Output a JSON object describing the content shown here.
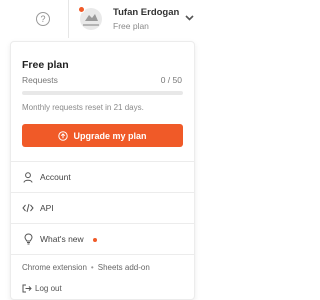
{
  "header": {
    "help_icon": "question-mark-icon",
    "user": {
      "name": "Tufan Erdogan",
      "plan": "Free plan",
      "has_notification": true
    }
  },
  "panel": {
    "plan_title": "Free plan",
    "requests_label": "Requests",
    "requests_count": "0 / 50",
    "requests_used_fraction": 0,
    "reset_text": "Monthly requests reset in 21 days.",
    "upgrade_label": "Upgrade my plan",
    "menu": [
      {
        "label": "Account",
        "icon": "user-icon"
      },
      {
        "label": "API",
        "icon": "code-icon"
      },
      {
        "label": "What's new",
        "icon": "lightbulb-icon",
        "badge": true
      }
    ],
    "links": [
      "Chrome extension",
      "Sheets add-on"
    ],
    "logout_label": "Log out"
  },
  "colors": {
    "accent": "#f05a28",
    "text": "#333333",
    "muted": "#8a8a8a"
  }
}
